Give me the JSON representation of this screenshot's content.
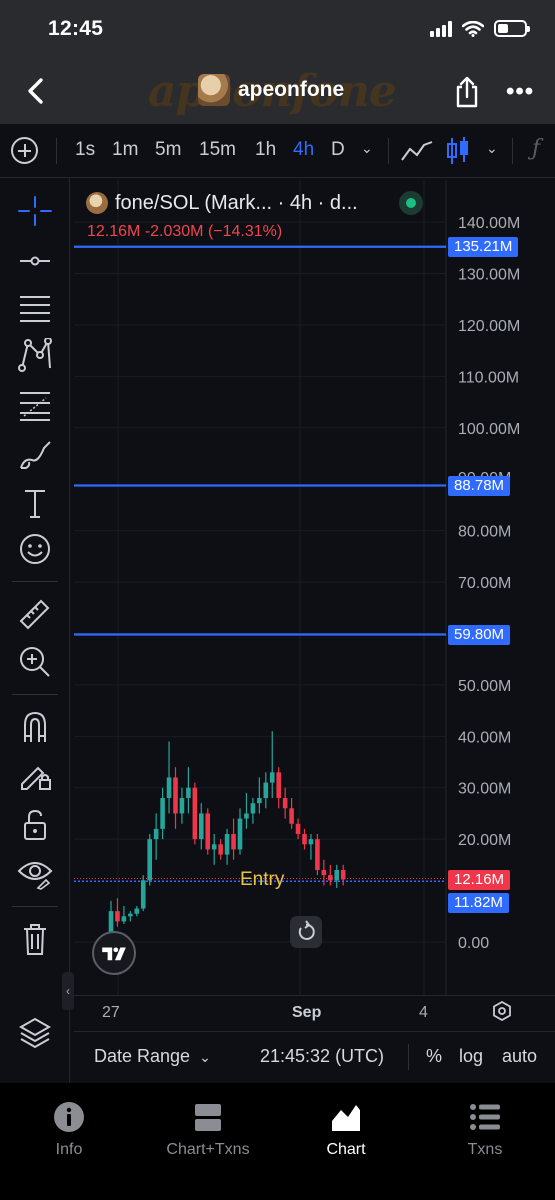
{
  "status_bar": {
    "time": "12:45"
  },
  "title_bar": {
    "watermark": "apeonfone",
    "title": "apeonfone"
  },
  "toolbar": {
    "timeframes": [
      "1s",
      "1m",
      "5m",
      "15m",
      "1h",
      "4h",
      "D"
    ],
    "active_timeframe": "4h"
  },
  "chart": {
    "header_title": "fone/SOL (Mark... · 4h · d...",
    "ohlc": "12.16M  -2.030M (−14.31%)",
    "entry_label": "Entry",
    "axis_labels": [
      "140.00M",
      "130.00M",
      "120.00M",
      "110.00M",
      "100.00M",
      "80.00M",
      "70.00M",
      "60.00M",
      "50.00M",
      "40.00M",
      "30.00M",
      "20.00M",
      "0.00"
    ],
    "price_tags": {
      "level_1": "135.21M",
      "level_2": "88.78M",
      "level_3": "59.80M",
      "current": "12.16M",
      "entry": "11.82M"
    },
    "date_labels": {
      "d1": "27",
      "d2": "Sep",
      "d3": "4"
    }
  },
  "bottom_controls": {
    "date_range": "Date Range",
    "time": "21:45:32 (UTC)",
    "percent": "%",
    "log": "log",
    "auto": "auto"
  },
  "tabs": [
    {
      "label": "Info"
    },
    {
      "label": "Chart+Txns"
    },
    {
      "label": "Chart"
    },
    {
      "label": "Txns"
    }
  ],
  "colors": {
    "accent": "#2f6bff",
    "up": "#26a69a",
    "down": "#f0364a",
    "entry": "#e8c547"
  },
  "chart_data": {
    "type": "candlestick",
    "title": "fone/SOL",
    "ylim": [
      0,
      140000000
    ],
    "horizontal_lines": [
      135210000,
      88780000,
      59800000,
      11820000
    ],
    "current_price": 12160000,
    "candles": [
      {
        "o": 2.0,
        "h": 8.0,
        "l": 1.0,
        "c": 6.0
      },
      {
        "o": 6.0,
        "h": 8.5,
        "l": 3.0,
        "c": 4.0
      },
      {
        "o": 4.0,
        "h": 7.0,
        "l": 3.5,
        "c": 5.0
      },
      {
        "o": 5.0,
        "h": 6.0,
        "l": 4.0,
        "c": 5.5
      },
      {
        "o": 5.5,
        "h": 7.0,
        "l": 5.0,
        "c": 6.5
      },
      {
        "o": 6.5,
        "h": 13.0,
        "l": 6.0,
        "c": 12.0
      },
      {
        "o": 12.0,
        "h": 21.0,
        "l": 11.0,
        "c": 20.0
      },
      {
        "o": 20.0,
        "h": 25.0,
        "l": 16.0,
        "c": 22.0
      },
      {
        "o": 22.0,
        "h": 30.0,
        "l": 20.0,
        "c": 28.0
      },
      {
        "o": 28.0,
        "h": 39.0,
        "l": 25.0,
        "c": 32.0
      },
      {
        "o": 32.0,
        "h": 34.0,
        "l": 22.0,
        "c": 25.0
      },
      {
        "o": 25.0,
        "h": 30.0,
        "l": 23.0,
        "c": 28.0
      },
      {
        "o": 28.0,
        "h": 34.0,
        "l": 25.0,
        "c": 30.0
      },
      {
        "o": 30.0,
        "h": 31.0,
        "l": 19.0,
        "c": 20.0
      },
      {
        "o": 20.0,
        "h": 27.0,
        "l": 18.0,
        "c": 25.0
      },
      {
        "o": 25.0,
        "h": 26.0,
        "l": 17.0,
        "c": 18.0
      },
      {
        "o": 18.0,
        "h": 21.0,
        "l": 15.0,
        "c": 19.0
      },
      {
        "o": 19.0,
        "h": 20.0,
        "l": 16.0,
        "c": 17.0
      },
      {
        "o": 17.0,
        "h": 22.0,
        "l": 15.0,
        "c": 21.0
      },
      {
        "o": 21.0,
        "h": 24.0,
        "l": 16.0,
        "c": 18.0
      },
      {
        "o": 18.0,
        "h": 26.0,
        "l": 17.0,
        "c": 24.0
      },
      {
        "o": 24.0,
        "h": 29.0,
        "l": 22.0,
        "c": 25.0
      },
      {
        "o": 25.0,
        "h": 28.0,
        "l": 23.0,
        "c": 27.0
      },
      {
        "o": 27.0,
        "h": 32.0,
        "l": 25.0,
        "c": 28.0
      },
      {
        "o": 28.0,
        "h": 33.0,
        "l": 26.0,
        "c": 31.0
      },
      {
        "o": 31.0,
        "h": 41.0,
        "l": 28.0,
        "c": 33.0
      },
      {
        "o": 33.0,
        "h": 34.0,
        "l": 26.0,
        "c": 28.0
      },
      {
        "o": 28.0,
        "h": 30.0,
        "l": 24.0,
        "c": 26.0
      },
      {
        "o": 26.0,
        "h": 28.0,
        "l": 22.0,
        "c": 23.0
      },
      {
        "o": 23.0,
        "h": 24.0,
        "l": 20.0,
        "c": 21.0
      },
      {
        "o": 21.0,
        "h": 22.0,
        "l": 18.0,
        "c": 19.0
      },
      {
        "o": 19.0,
        "h": 21.0,
        "l": 16.0,
        "c": 20.0
      },
      {
        "o": 20.0,
        "h": 21.0,
        "l": 13.0,
        "c": 14.0
      },
      {
        "o": 14.0,
        "h": 16.0,
        "l": 11.0,
        "c": 13.0
      },
      {
        "o": 13.0,
        "h": 15.0,
        "l": 11.0,
        "c": 12.0
      },
      {
        "o": 12.0,
        "h": 15.0,
        "l": 10.5,
        "c": 14.0
      },
      {
        "o": 14.0,
        "h": 15.0,
        "l": 11.0,
        "c": 12.16
      }
    ]
  }
}
